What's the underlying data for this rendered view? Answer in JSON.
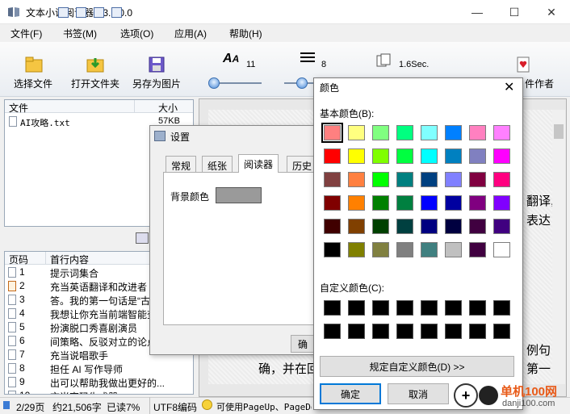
{
  "window": {
    "title": "文本小说阅读器 V3.1.0.0",
    "controls": [
      "—",
      "☐",
      "✕"
    ]
  },
  "menu": [
    "文件(F)",
    "书签(M)",
    "选项(O)",
    "应用(A)",
    "帮助(H)"
  ],
  "toolbar": {
    "choose_file": "选择文件",
    "open_folder": "打开文件夹",
    "save_as_image": "另存为图片",
    "font_size": "11",
    "line_spacing": "8",
    "interval": "1.6Sec.",
    "author": "件作者"
  },
  "file_list": {
    "headers": [
      "文件",
      "大小"
    ],
    "rows": [
      {
        "name": "AI攻略.txt",
        "size": "57KB"
      }
    ]
  },
  "pages": {
    "headers": [
      "页码",
      "首行内容"
    ],
    "rows": [
      {
        "num": "1",
        "text": "提示词集合"
      },
      {
        "num": "2",
        "text": "充当英语翻译和改进者"
      },
      {
        "num": "3",
        "text": "答。我的第一句话是“古"
      },
      {
        "num": "4",
        "text": "我想让你充当前端智能查员"
      },
      {
        "num": "5",
        "text": "扮演脱口秀喜剧演员"
      },
      {
        "num": "6",
        "text": "间策略、反驳对立的论点"
      },
      {
        "num": "7",
        "text": "充当说唱歌手"
      },
      {
        "num": "8",
        "text": "担任 AI 写作导师"
      },
      {
        "num": "9",
        "text": "出可以帮助我做出更好的..."
      },
      {
        "num": "10",
        "text": "充当密码生成器"
      }
    ]
  },
  "reading": {
    "text_right_1": "翻译,",
    "text_right_2": "表达",
    "text_right_3": "例句",
    "text_right_4": "第一",
    "text_bottom": "确，并在回"
  },
  "status": {
    "page": "2/29页",
    "chars": "约21,506字",
    "read": "已读7%",
    "encoding": "UTF8编码",
    "hint": "可使用PageUp、PageDo"
  },
  "settings": {
    "title": "设置",
    "tabs": [
      "常规",
      "纸张",
      "阅读器",
      "历史"
    ],
    "bg_color_label": "背景颜色",
    "bg_color": "#9a9a9a",
    "ok_partial": "确"
  },
  "color_dialog": {
    "title": "颜色",
    "basic_label": "基本颜色(B):",
    "custom_label": "自定义颜色(C):",
    "define_custom": "规定自定义颜色(D) >>",
    "ok": "确定",
    "cancel": "取消",
    "basic_colors": [
      [
        "#ff8080",
        "#ffff80",
        "#80ff80",
        "#00ff80",
        "#80ffff",
        "#0080ff",
        "#ff80c0",
        "#ff80ff"
      ],
      [
        "#ff0000",
        "#ffff00",
        "#80ff00",
        "#00ff40",
        "#00ffff",
        "#0080c0",
        "#8080c0",
        "#ff00ff"
      ],
      [
        "#804040",
        "#ff8040",
        "#00ff00",
        "#008080",
        "#004080",
        "#8080ff",
        "#800040",
        "#ff0080"
      ],
      [
        "#800000",
        "#ff8000",
        "#008000",
        "#008040",
        "#0000ff",
        "#0000a0",
        "#800080",
        "#8000ff"
      ],
      [
        "#400000",
        "#804000",
        "#004000",
        "#004040",
        "#000080",
        "#000040",
        "#400040",
        "#400080"
      ],
      [
        "#000000",
        "#808000",
        "#808040",
        "#808080",
        "#408080",
        "#c0c0c0",
        "#400040",
        "#ffffff"
      ]
    ],
    "selected_color": "#ff8080"
  },
  "watermark": {
    "text1": "单机100网",
    "text2": "danji100.com"
  }
}
